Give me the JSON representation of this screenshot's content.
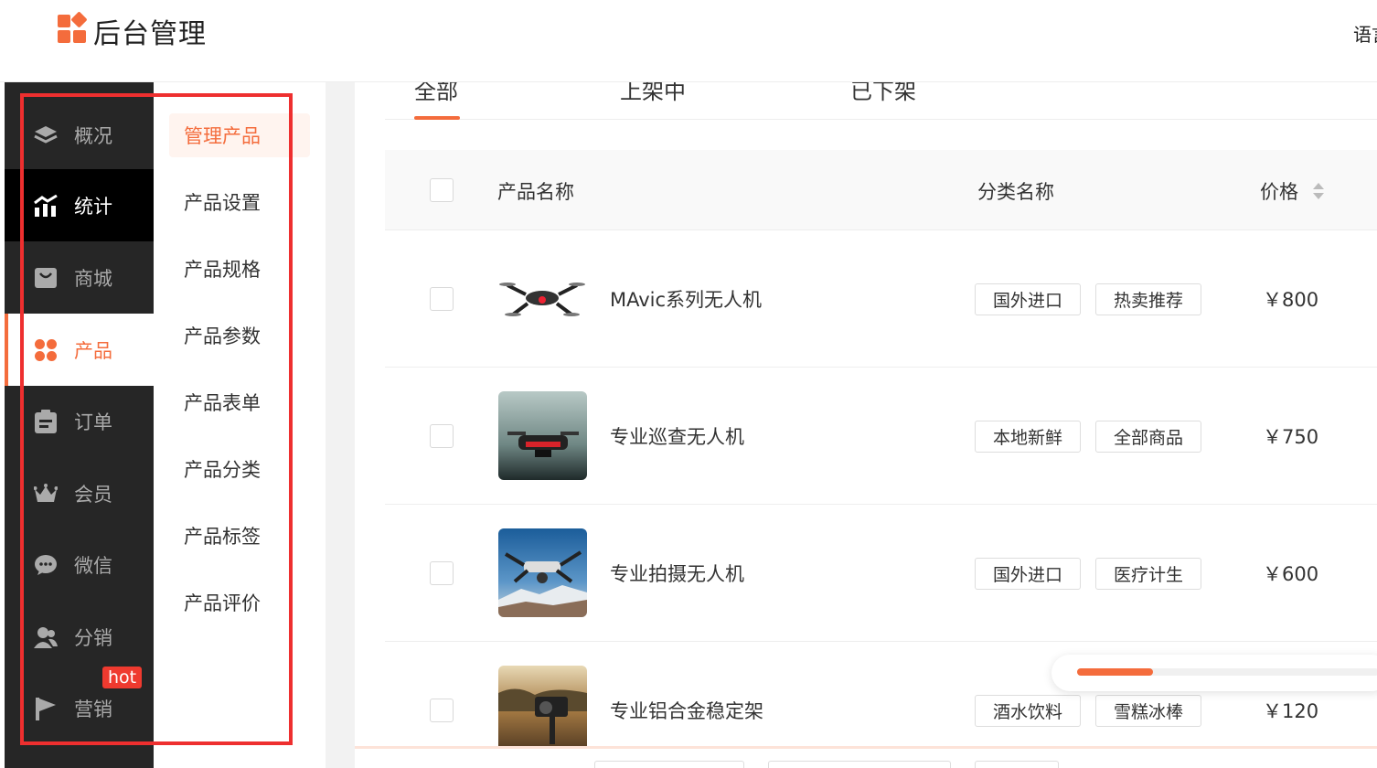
{
  "header": {
    "brand": "后台管理",
    "lang": "语言"
  },
  "sidebar": {
    "items": [
      {
        "label": "概况",
        "icon": "layers-icon"
      },
      {
        "label": "统计",
        "icon": "chart-icon"
      },
      {
        "label": "商城",
        "icon": "store-icon"
      },
      {
        "label": "产品",
        "icon": "grid-icon"
      },
      {
        "label": "订单",
        "icon": "order-icon"
      },
      {
        "label": "会员",
        "icon": "crown-icon"
      },
      {
        "label": "微信",
        "icon": "wechat-icon"
      },
      {
        "label": "分销",
        "icon": "users-icon"
      },
      {
        "label": "营销",
        "icon": "flag-icon"
      }
    ],
    "hot_badge": "hot"
  },
  "submenu": {
    "items": [
      "管理产品",
      "产品设置",
      "产品规格",
      "产品参数",
      "产品表单",
      "产品分类",
      "产品标签",
      "产品评价"
    ]
  },
  "tabs": [
    "全部",
    "上架中",
    "已下架"
  ],
  "table": {
    "headers": {
      "name": "产品名称",
      "category": "分类名称",
      "price": "价格"
    },
    "rows": [
      {
        "name": "MAvic系列无人机",
        "tags": [
          "国外进口",
          "热卖推荐"
        ],
        "price": "￥800"
      },
      {
        "name": "专业巡查无人机",
        "tags": [
          "本地新鲜",
          "全部商品"
        ],
        "price": "￥750"
      },
      {
        "name": "专业拍摄无人机",
        "tags": [
          "国外进口",
          "医疗计生"
        ],
        "price": "￥600"
      },
      {
        "name": "专业铝合金稳定架",
        "tags": [
          "酒水饮料",
          "雪糕冰棒"
        ],
        "price": "￥120"
      }
    ]
  },
  "scroll_progress": 0.25,
  "colors": {
    "accent": "#f46c3c",
    "sidebar_bg": "#262626",
    "highlight_frame": "#ee2f2f"
  }
}
